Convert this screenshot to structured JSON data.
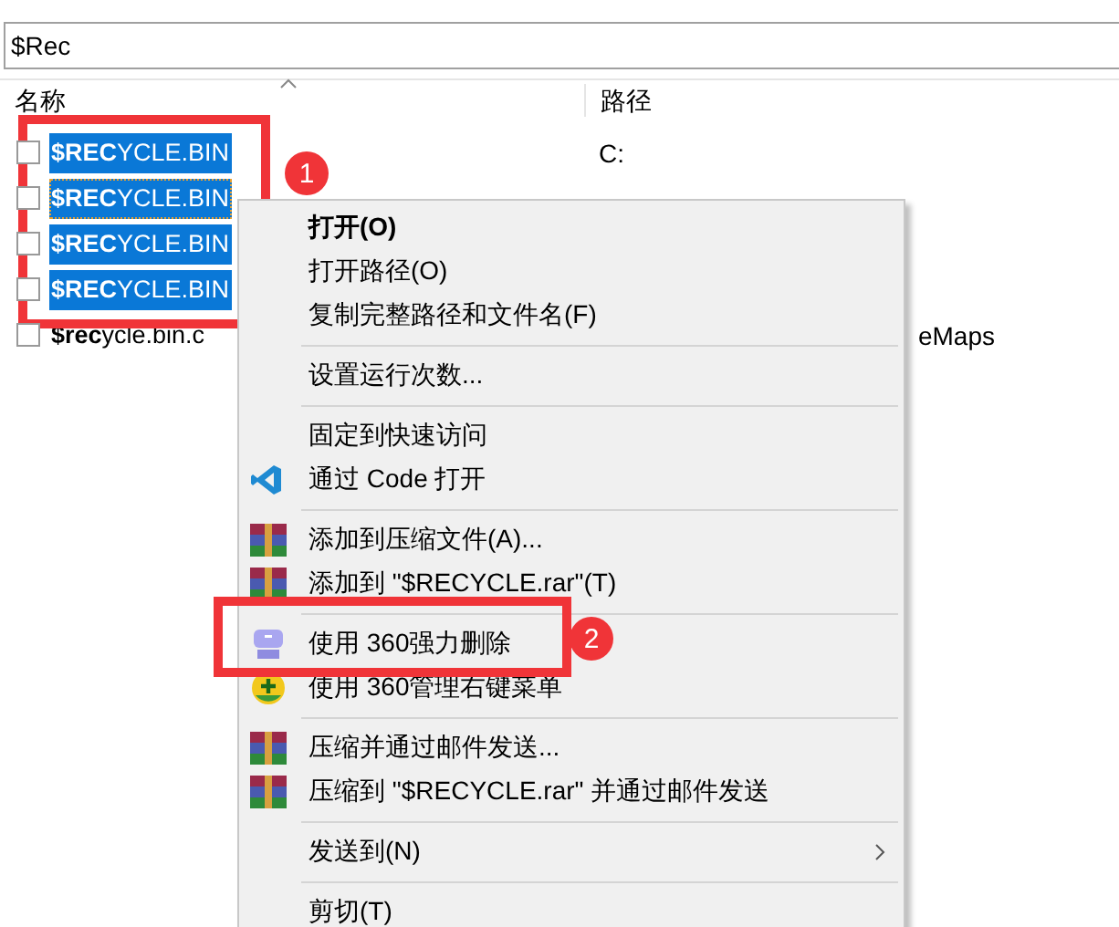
{
  "search": {
    "value": "$Rec"
  },
  "table": {
    "columns": [
      "名称",
      "路径"
    ],
    "rows": [
      {
        "name": "**$REC**YCLE.BIN",
        "path": "C:",
        "checked": false,
        "selected": true,
        "focused": false,
        "clipped": false
      },
      {
        "name": "**$REC**YCLE.BIN",
        "checked": false,
        "selected": true,
        "focused": true,
        "clipped": false
      },
      {
        "name": "**$REC**YCLE.BIN",
        "checked": false,
        "selected": true,
        "focused": false,
        "clipped": false
      },
      {
        "name": "**$REC**YCLE.BIN",
        "checked": false,
        "selected": true,
        "focused": false,
        "clipped": false
      },
      {
        "name": "**$rec**ycle.bin.c",
        "path": "eMaps",
        "checked": false,
        "selected": false,
        "focused": false,
        "clipped": true
      }
    ]
  },
  "context_menu": [
    {
      "kind": "plain",
      "label": "打开(O)",
      "bold": true,
      "submenu": false
    },
    {
      "kind": "plain",
      "label": "打开路径(O)",
      "bold": false,
      "submenu": false
    },
    {
      "kind": "plain",
      "label": "复制完整路径和文件名(F)",
      "bold": false,
      "submenu": false
    },
    {
      "kind": "separator"
    },
    {
      "kind": "plain",
      "label": "设置运行次数...",
      "bold": false,
      "submenu": false
    },
    {
      "kind": "separator"
    },
    {
      "kind": "plain",
      "label": "固定到快速访问",
      "bold": false,
      "submenu": false
    },
    {
      "kind": "code",
      "label": "通过 Code 打开",
      "bold": false,
      "submenu": false
    },
    {
      "kind": "separator"
    },
    {
      "kind": "archive",
      "label": "添加到压缩文件(A)...",
      "bold": false,
      "submenu": false
    },
    {
      "kind": "archive",
      "label": "添加到 \"$RECYCLE.rar\"(T)",
      "bold": false,
      "submenu": false
    },
    {
      "kind": "separator"
    },
    {
      "kind": "shredder",
      "label": "使用 360强力删除",
      "bold": false,
      "submenu": false
    },
    {
      "kind": "plus",
      "label": "使用 360管理右键菜单",
      "bold": false,
      "submenu": false
    },
    {
      "kind": "separator"
    },
    {
      "kind": "archive",
      "label": "压缩并通过邮件发送...",
      "bold": false,
      "submenu": false
    },
    {
      "kind": "archive",
      "label": "压缩到 \"$RECYCLE.rar\" 并通过邮件发送",
      "bold": false,
      "submenu": false
    },
    {
      "kind": "separator"
    },
    {
      "kind": "plain",
      "label": "发送到(N)",
      "bold": false,
      "submenu": true
    },
    {
      "kind": "separator"
    },
    {
      "kind": "plain",
      "label": "剪切(T)",
      "bold": false,
      "submenu": false
    }
  ],
  "callouts": [
    {
      "label": "1"
    },
    {
      "label": "2"
    }
  ]
}
